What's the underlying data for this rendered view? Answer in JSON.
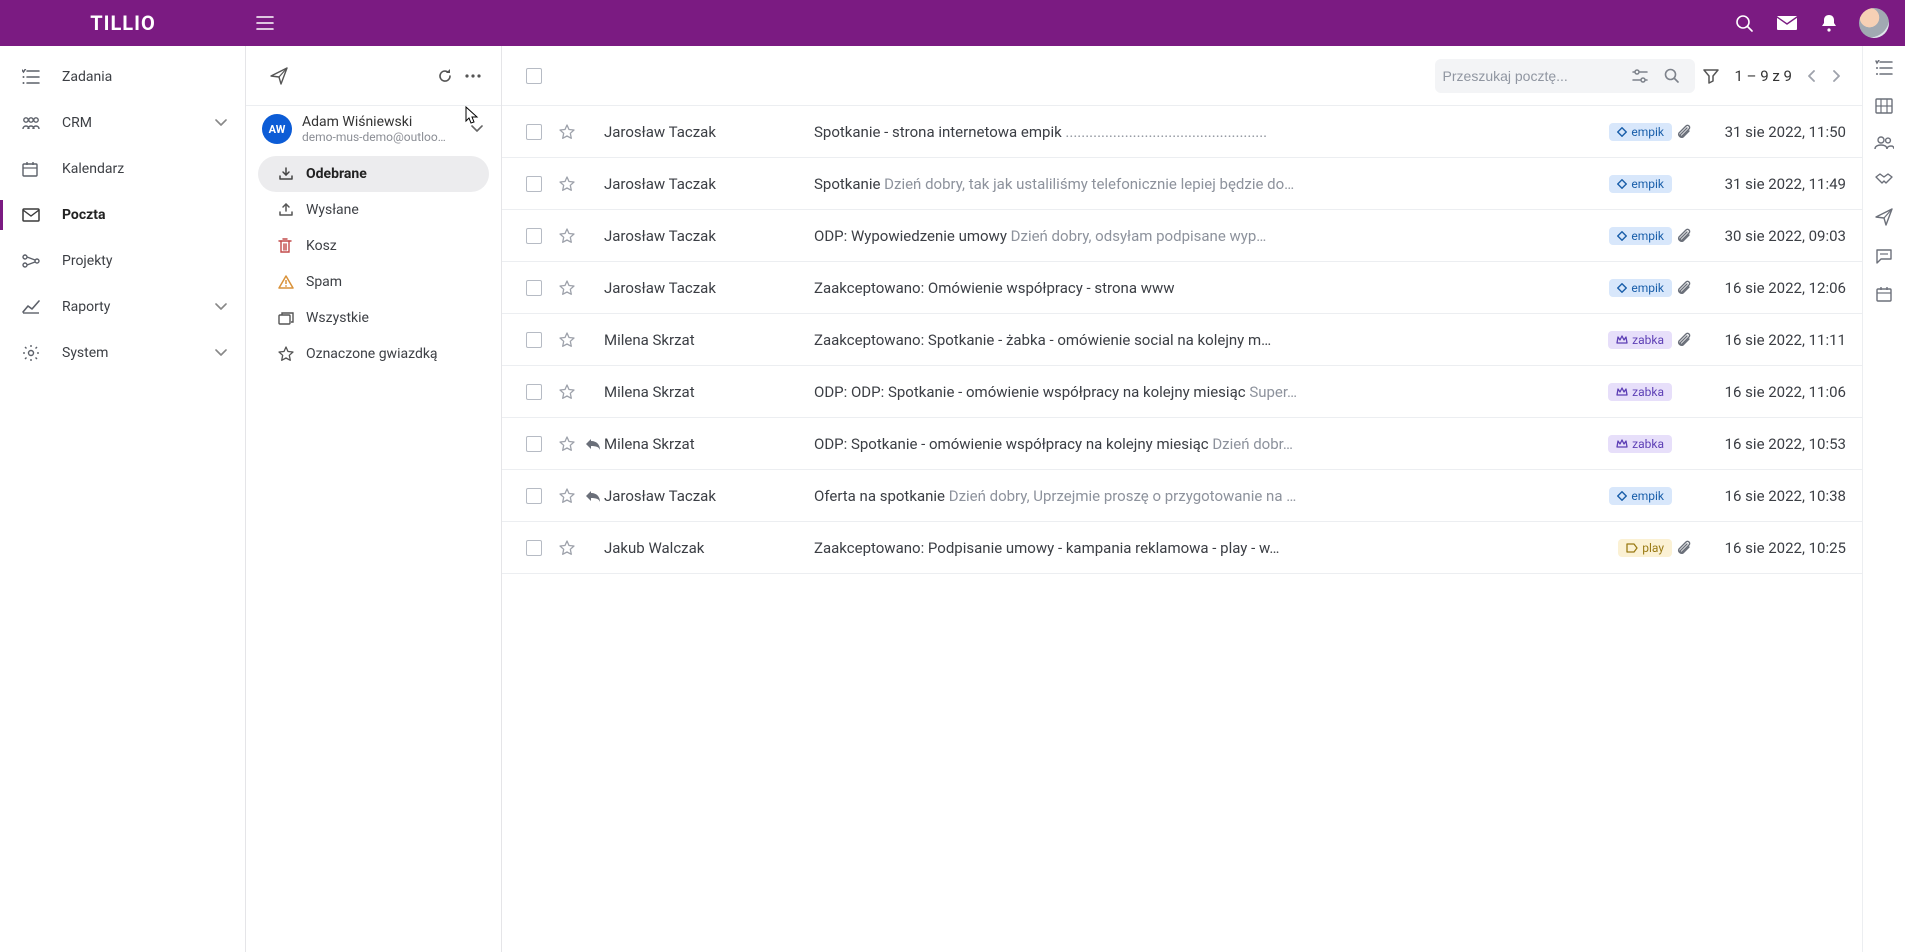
{
  "brand": "TILLIO",
  "sidebar": {
    "items": [
      {
        "label": "Zadania",
        "icon": "tasks",
        "expandable": false,
        "active": false
      },
      {
        "label": "CRM",
        "icon": "crm",
        "expandable": true,
        "active": false
      },
      {
        "label": "Kalendarz",
        "icon": "calendar",
        "expandable": false,
        "active": false
      },
      {
        "label": "Poczta",
        "icon": "mail",
        "expandable": false,
        "active": true
      },
      {
        "label": "Projekty",
        "icon": "projects",
        "expandable": false,
        "active": false
      },
      {
        "label": "Raporty",
        "icon": "reports",
        "expandable": true,
        "active": false
      },
      {
        "label": "System",
        "icon": "settings",
        "expandable": true,
        "active": false
      }
    ]
  },
  "mail_sidebar": {
    "account": {
      "initials": "AW",
      "name": "Adam Wiśniewski",
      "email": "demo-mus-demo@outloo…"
    },
    "folders": [
      {
        "label": "Odebrane",
        "icon": "inbox-dl",
        "selected": true
      },
      {
        "label": "Wysłane",
        "icon": "sent-ul",
        "selected": false
      },
      {
        "label": "Kosz",
        "icon": "trash",
        "selected": false
      },
      {
        "label": "Spam",
        "icon": "spam",
        "selected": false
      },
      {
        "label": "Wszystkie",
        "icon": "all",
        "selected": false
      },
      {
        "label": "Oznaczone gwiazdką",
        "icon": "star-outline",
        "selected": false
      }
    ]
  },
  "toolbar": {
    "search_placeholder": "Przeszukaj pocztę...",
    "pager": "1 – 9 z 9"
  },
  "messages": [
    {
      "sender": "Jarosław Taczak",
      "subject": "Spotkanie - strona internetowa empik",
      "preview": " ...................................................",
      "tag": "empik",
      "tag_style": "empik",
      "attachment": true,
      "replied": false,
      "date": "31 sie 2022, 11:50"
    },
    {
      "sender": "Jarosław Taczak",
      "subject": "Spotkanie",
      "preview": " Dzień dobry, tak jak ustaliliśmy telefonicznie lepiej będzie do…",
      "tag": "empik",
      "tag_style": "empik",
      "attachment": false,
      "replied": false,
      "date": "31 sie 2022, 11:49"
    },
    {
      "sender": "Jarosław Taczak",
      "subject": "ODP: Wypowiedzenie umowy",
      "preview": " Dzień dobry, odsyłam podpisane wyp…",
      "tag": "empik",
      "tag_style": "empik",
      "attachment": true,
      "replied": false,
      "date": "30 sie 2022, 09:03"
    },
    {
      "sender": "Jarosław Taczak",
      "subject": "Zaakceptowano: Omówienie współpracy - strona www",
      "preview": "",
      "tag": "empik",
      "tag_style": "empik",
      "attachment": true,
      "replied": false,
      "date": "16 sie 2022, 12:06"
    },
    {
      "sender": "Milena Skrzat",
      "subject": "Zaakceptowano: Spotkanie - żabka - omówienie social na kolejny m…",
      "preview": "",
      "tag": "zabka",
      "tag_style": "zabka",
      "attachment": true,
      "replied": false,
      "date": "16 sie 2022, 11:11"
    },
    {
      "sender": "Milena Skrzat",
      "subject": "ODP: ODP: Spotkanie - omówienie współpracy na kolejny miesiąc",
      "preview": " Super…",
      "tag": "zabka",
      "tag_style": "zabka",
      "attachment": false,
      "replied": false,
      "date": "16 sie 2022, 11:06"
    },
    {
      "sender": "Milena Skrzat",
      "subject": "ODP: Spotkanie - omówienie współpracy na kolejny miesiąc",
      "preview": " Dzień dobr…",
      "tag": "zabka",
      "tag_style": "zabka",
      "attachment": false,
      "replied": true,
      "date": "16 sie 2022, 10:53"
    },
    {
      "sender": "Jarosław Taczak",
      "subject": "Oferta na spotkanie",
      "preview": " Dzień dobry, Uprzejmie proszę o przygotowanie na …",
      "tag": "empik",
      "tag_style": "empik",
      "attachment": false,
      "replied": true,
      "date": "16 sie 2022, 10:38"
    },
    {
      "sender": "Jakub Walczak",
      "subject": "Zaakceptowano: Podpisanie umowy - kampania reklamowa - play - w…",
      "preview": "",
      "tag": "play",
      "tag_style": "play",
      "attachment": true,
      "replied": false,
      "date": "16 sie 2022, 10:25"
    }
  ]
}
